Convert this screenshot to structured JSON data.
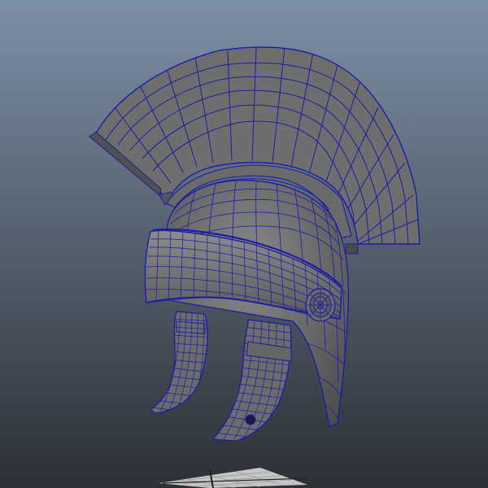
{
  "viewport": {
    "background_top": "#7d8fa6",
    "background_bottom": "#2d3035",
    "shading_mode": "wireframe-on-shaded"
  },
  "model": {
    "name": "helmet",
    "surface_color": "#7a7a7a",
    "surface_dark": "#555555",
    "wire_color": "#1d1da6"
  },
  "ground_grid": {
    "visible": true,
    "color": "#c8c8c8"
  }
}
